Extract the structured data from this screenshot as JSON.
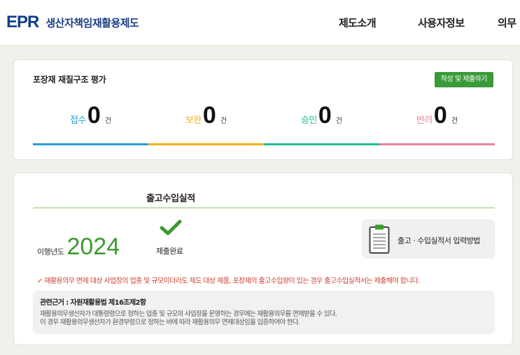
{
  "header": {
    "logo_mark": "EPR",
    "logo_text": "생산자책임재활용제도",
    "nav": [
      "제도소개",
      "사용자정보",
      "의무"
    ]
  },
  "evaluation": {
    "title": "포장재 재질구조 평가",
    "submit_button": "작성 및 제출하기",
    "stats": [
      {
        "label": "접수",
        "count": "0",
        "unit": "건",
        "color": "#2a9fd6"
      },
      {
        "label": "보완",
        "count": "0",
        "unit": "건",
        "color": "#f2b21a"
      },
      {
        "label": "승인",
        "count": "0",
        "unit": "건",
        "color": "#1fbf8f"
      },
      {
        "label": "반려",
        "count": "0",
        "unit": "건",
        "color": "#e9849a"
      }
    ]
  },
  "shipping": {
    "title": "출고수입실적",
    "year_label": "이행년도",
    "year": "2024",
    "status": "제출완료",
    "guide_button": "출고 · 수입실적서 입력방법",
    "notice": "✓ 재활용의무 면제 대상 사업장의 업종 및 규모이더라도 제도 대상 제품, 포장재의 출고수입량이 있는 경우 출고수입실적서는 제출해야 합니다.",
    "reference": {
      "title": "관련근거 : 자원재활용법 제16조제2항",
      "line1": "재활용의무생산자가 대통령령으로 정하는 업종 및 규모의 사업장을 운영하는 경우에는 재활용의무를 면제받을 수 있다.",
      "line2": "이 경우 재활용의무생산자가 환경부령으로 정하는 바에 따라 재활용의무 면제대상임을 입증하여야 한다."
    }
  },
  "colors": {
    "accent_green": "#3a9a3a",
    "year_green": "#3c9a2f",
    "notice_red": "#d23f2e"
  }
}
